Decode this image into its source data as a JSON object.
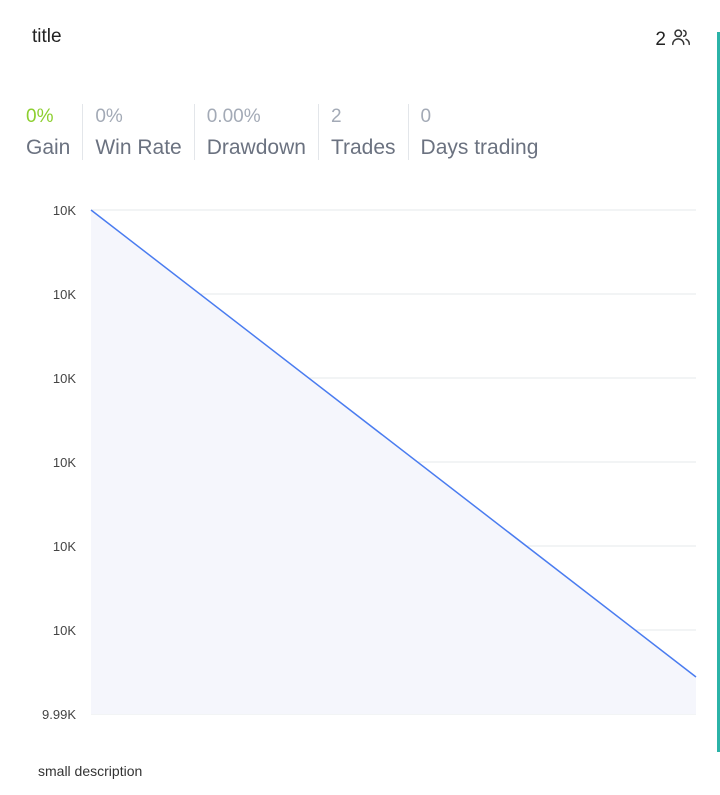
{
  "card": {
    "title": "title",
    "member_count": "2",
    "member_icon": "users-icon",
    "description": "small description"
  },
  "stats": [
    {
      "value": "0%",
      "label": "Gain"
    },
    {
      "value": "0%",
      "label": "Win Rate"
    },
    {
      "value": "0.00%",
      "label": "Drawdown"
    },
    {
      "value": "2",
      "label": "Trades"
    },
    {
      "value": "0",
      "label": "Days trading"
    }
  ],
  "colors": {
    "gain": "#8ccf2f",
    "muted": "#a3aab6",
    "line": "#4a7cf0",
    "area": "#f5f6fc",
    "accent": "#2bb3a8"
  },
  "chart_data": {
    "type": "area",
    "y_tick_labels": [
      "10K",
      "10K",
      "10K",
      "10K",
      "10K",
      "10K",
      "9.99K"
    ],
    "x": [
      0,
      1
    ],
    "values": [
      1.0,
      0.0
    ],
    "grid": true,
    "legend": "none"
  }
}
